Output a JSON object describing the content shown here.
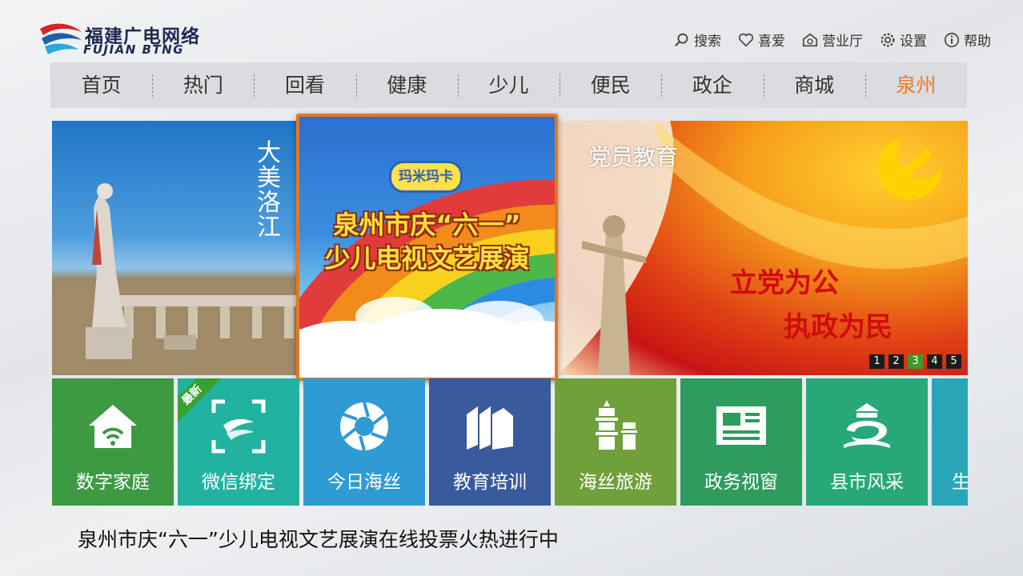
{
  "logo": {
    "cn": "福建广电网络",
    "en": "FUJIAN BTNG"
  },
  "toplinks": [
    {
      "label": "搜索",
      "icon": "search-icon"
    },
    {
      "label": "喜爱",
      "icon": "heart-icon"
    },
    {
      "label": "营业厅",
      "icon": "hall-icon"
    },
    {
      "label": "设置",
      "icon": "gear-icon"
    },
    {
      "label": "帮助",
      "icon": "info-icon"
    }
  ],
  "nav": [
    "首页",
    "热门",
    "回看",
    "健康",
    "少儿",
    "便民",
    "政企",
    "商城",
    "泉州"
  ],
  "nav_active_index": 8,
  "banner": {
    "left_vertical": [
      "大",
      "美",
      "洛",
      "江"
    ],
    "focus": {
      "brand": "玛米玛卡",
      "line1": "泉州市庆“六一”",
      "line2": "少儿电视文艺展演"
    },
    "right": {
      "tag": "党员教育",
      "line1": "立党为公",
      "line2": "执政为民"
    },
    "pager": [
      "1",
      "2",
      "3",
      "4",
      "5"
    ],
    "pager_active_index": 2
  },
  "tiles": [
    {
      "label": "数字家庭",
      "color": "#3d9a43",
      "icon": "home-wifi-icon",
      "badge": ""
    },
    {
      "label": "微信绑定",
      "color": "#22b3a0",
      "icon": "scan-icon",
      "badge": "最新"
    },
    {
      "label": "今日海丝",
      "color": "#2f9bd4",
      "icon": "aperture-icon",
      "badge": ""
    },
    {
      "label": "教育培训",
      "color": "#3a5a9e",
      "icon": "books-icon",
      "badge": ""
    },
    {
      "label": "海丝旅游",
      "color": "#6fa03a",
      "icon": "pagoda-icon",
      "badge": ""
    },
    {
      "label": "政务视窗",
      "color": "#2d9c5c",
      "icon": "news-icon",
      "badge": ""
    },
    {
      "label": "县市风采",
      "color": "#28a878",
      "icon": "landmark-icon",
      "badge": ""
    },
    {
      "label": "生",
      "color": "#2aa5b8",
      "icon": "partial-icon",
      "badge": ""
    }
  ],
  "caption": "泉州市庆“六一”少儿电视文艺展演在线投票火热进行中"
}
